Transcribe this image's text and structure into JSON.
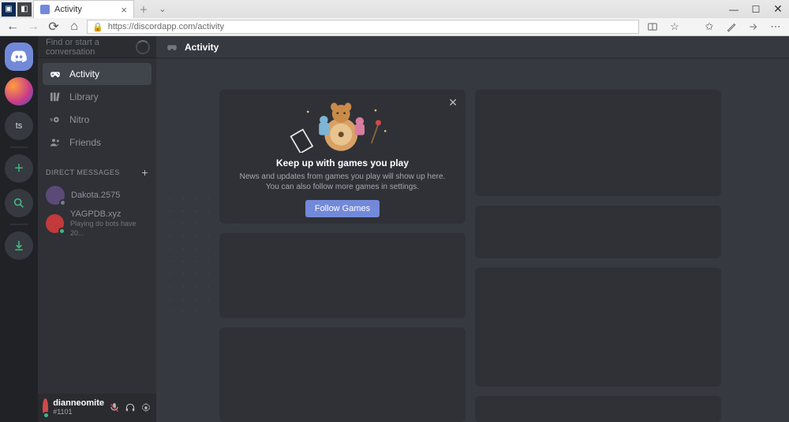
{
  "browser": {
    "tab_title": "Activity",
    "url": "https://discordapp.com/activity"
  },
  "servers": {
    "ts_label": "ts"
  },
  "sidebar": {
    "search_placeholder": "Find or start a conversation",
    "nav": [
      {
        "label": "Activity"
      },
      {
        "label": "Library"
      },
      {
        "label": "Nitro"
      },
      {
        "label": "Friends"
      }
    ],
    "dm_header": "DIRECT MESSAGES",
    "dms": [
      {
        "name": "Dakota.2575"
      },
      {
        "name": "YAGPDB.xyz",
        "status": "Playing do bots have 20..."
      }
    ]
  },
  "user": {
    "name": "dianneomite",
    "disc": "#1101"
  },
  "main": {
    "header": "Activity",
    "hero": {
      "title": "Keep up with games you play",
      "desc": "News and updates from games you play will show up here. You can also follow more games in settings.",
      "button": "Follow Games"
    }
  }
}
